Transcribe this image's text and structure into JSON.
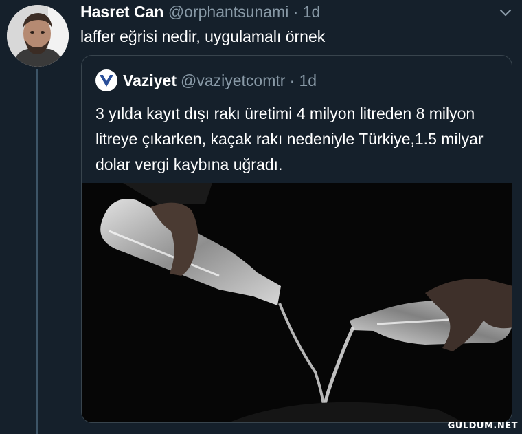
{
  "tweet": {
    "author_name": "Hasret Can",
    "handle": "@orphantsunami",
    "time": "· 1d",
    "text": "laffer eğrisi nedir, uygulamalı örnek"
  },
  "quoted_tweet": {
    "author_name": "Vaziyet",
    "handle": "@vaziyetcomtr",
    "time": "· 1d",
    "text": "3 yılda kayıt dışı rakı üretimi 4 milyon litreden 8 milyon litreye çıkarken, kaçak rakı nedeniyle Türkiye,1.5 milyar dolar vergi kaybına uğradı."
  },
  "watermark": "GULDUM.NET",
  "icons": {
    "menu": "chevron-down-icon",
    "source_logo": "vaziyet-logo-icon"
  },
  "colors": {
    "background": "#15202b",
    "secondary_text": "#8899a6",
    "border": "#38444d"
  }
}
